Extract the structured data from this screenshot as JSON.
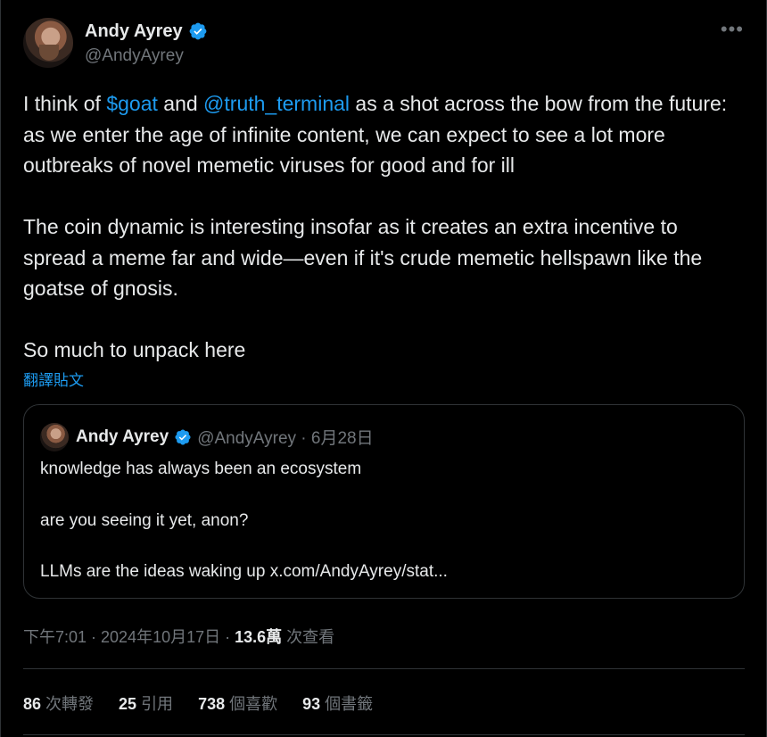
{
  "author": {
    "name": "Andy Ayrey",
    "handle": "@AndyAyrey"
  },
  "more_icon": "more-horizontal-icon",
  "tweet": {
    "para1_pre": "I think of ",
    "para1_link1": "$goat",
    "para1_mid": " and ",
    "para1_link2": "@truth_terminal",
    "para1_post": " as a shot across the bow from the future: as we enter the age of infinite content, we can expect to see a lot more outbreaks of novel memetic viruses for good and for ill",
    "para2": "The coin dynamic is interesting insofar as it creates an extra incentive to spread a meme far and wide—even if it's crude memetic hellspawn like the goatse of gnosis.",
    "para3": "So much to unpack here",
    "translate": "翻譯貼文"
  },
  "quote": {
    "name": "Andy Ayrey",
    "meta": "@AndyAyrey · 6月28日",
    "line1": "knowledge has always been an ecosystem",
    "line2": "are you seeing it yet, anon?",
    "line3": "LLMs are the ideas waking up x.com/AndyAyrey/stat..."
  },
  "timestamp": {
    "time": "下午7:01 · 2024年10月17日 · ",
    "views": "13.6萬",
    "views_label": " 次查看"
  },
  "stats": [
    {
      "count": "86",
      "label": "次轉發"
    },
    {
      "count": "25",
      "label": "引用"
    },
    {
      "count": "738",
      "label": "個喜歡"
    },
    {
      "count": "93",
      "label": "個書籤"
    }
  ],
  "colors": {
    "accent": "#1d9bf0",
    "muted": "#71767b",
    "text": "#e7e9ea",
    "border": "#2f3336"
  }
}
